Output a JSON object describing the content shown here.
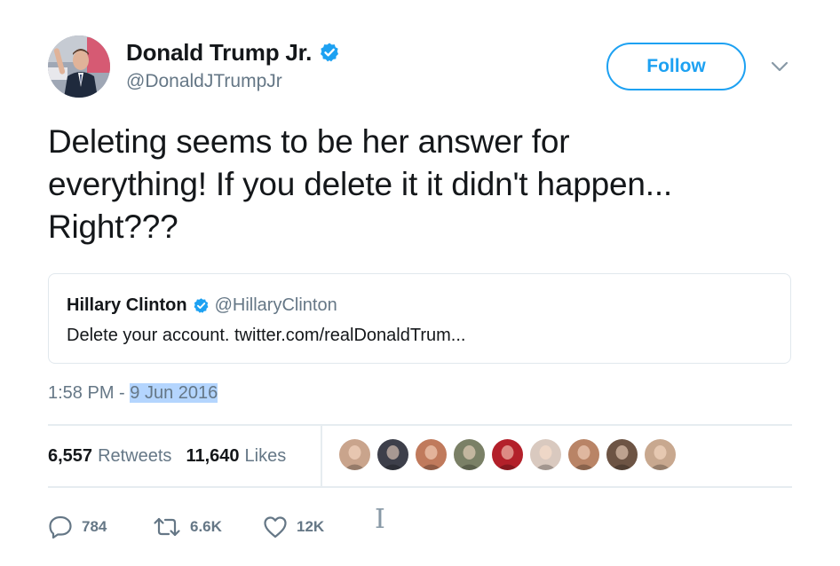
{
  "author": {
    "display_name": "Donald Trump Jr.",
    "handle": "@DonaldJTrumpJr",
    "verified": true,
    "avatar_icon": "profile-photo"
  },
  "follow_label": "Follow",
  "tweet": {
    "text_lines": [
      "Deleting seems to be her answer for",
      "everything! If you delete it it didn't happen...",
      "Right???"
    ]
  },
  "quoted_tweet": {
    "display_name": "Hillary Clinton",
    "handle": "@HillaryClinton",
    "verified": true,
    "text": "Delete your account. twitter.com/realDonaldTrum..."
  },
  "timestamp": {
    "time": "1:58 PM - ",
    "date": "9 Jun 2016"
  },
  "stats": {
    "retweets_count": "6,557",
    "retweets_label": "Retweets",
    "likes_count": "11,640",
    "likes_label": "Likes"
  },
  "likers": [
    {
      "color": "#c9a48c"
    },
    {
      "color": "#3d3f4a"
    },
    {
      "color": "#c07a5c"
    },
    {
      "color": "#7a8066"
    },
    {
      "color": "#b3202a"
    },
    {
      "color": "#d9c9bf"
    },
    {
      "color": "#b98466"
    },
    {
      "color": "#6d5444"
    },
    {
      "color": "#c8a88f"
    }
  ],
  "actions": {
    "reply_count": "784",
    "retweet_count": "6.6K",
    "like_count": "12K"
  },
  "cursor_glyph": "I",
  "colors": {
    "accent": "#1da1f2",
    "muted": "#657786",
    "text": "#14171a",
    "border": "#e1e8ed",
    "selection": "#b4d5fe"
  }
}
